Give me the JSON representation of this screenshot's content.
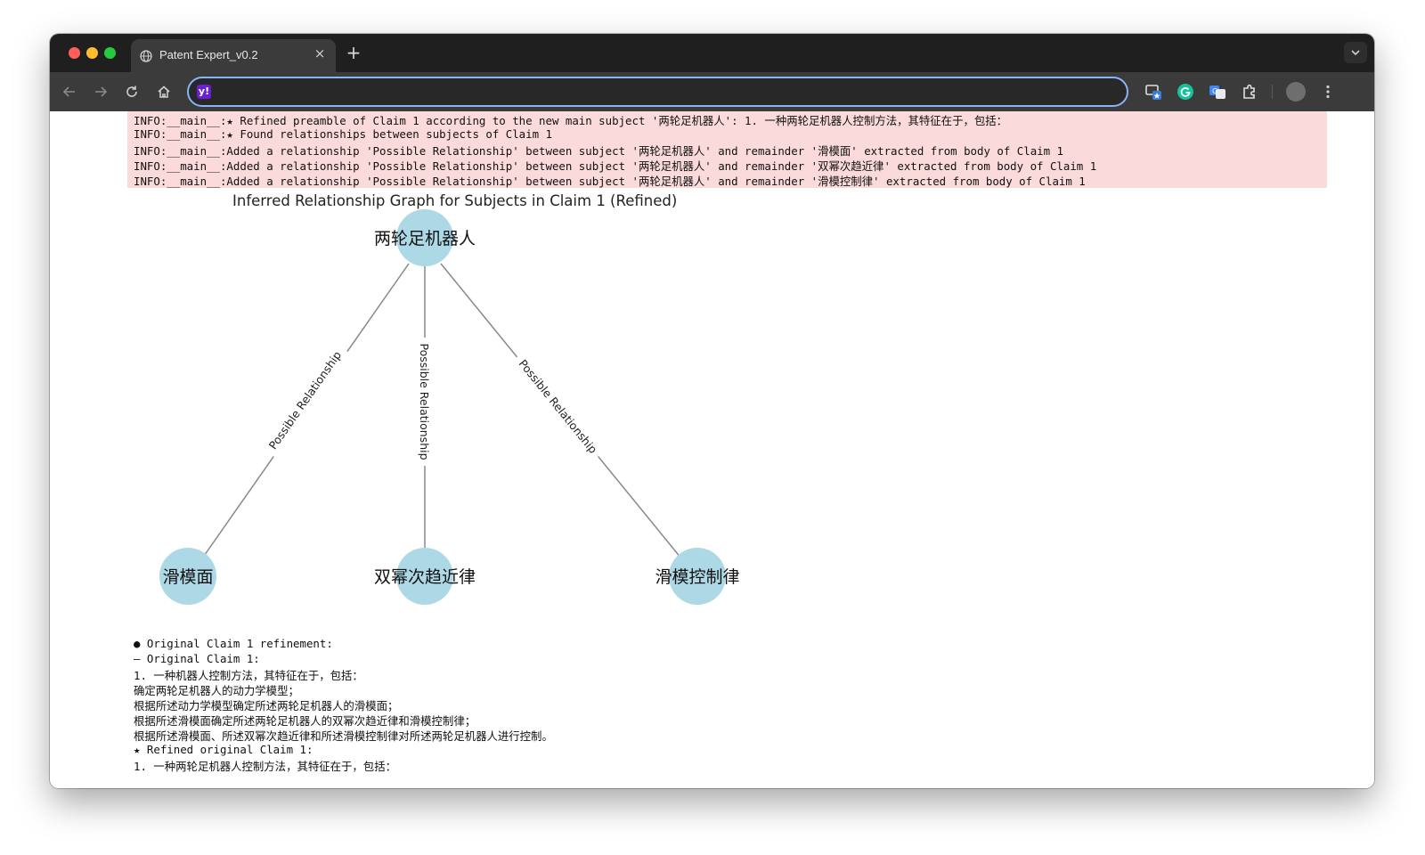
{
  "browser": {
    "tab_title": "Patent Expert_v0.2",
    "tab_close": "×",
    "new_tab": "+",
    "address_value": "",
    "omnibox_icon_text": "y!"
  },
  "log": {
    "lines": [
      "INFO:__main__:★ Refined preamble of Claim 1 according to the new main subject '两轮足机器人': 1. 一种两轮足机器人控制方法，其特征在于，包括：",
      "INFO:__main__:★ Found relationships between subjects of Claim 1",
      "INFO:__main__:Added a relationship 'Possible Relationship' between subject '两轮足机器人' and remainder '滑模面' extracted from body of Claim 1",
      "INFO:__main__:Added a relationship 'Possible Relationship' between subject '两轮足机器人' and remainder '双幂次趋近律' extracted from body of Claim 1",
      "INFO:__main__:Added a relationship 'Possible Relationship' between subject '两轮足机器人' and remainder '滑模控制律' extracted from body of Claim 1"
    ]
  },
  "graph": {
    "title": "Inferred Relationship Graph for Subjects in Claim 1 (Refined)",
    "node_color": "#add8e6",
    "edge_color": "#888888",
    "nodes": {
      "root": "两轮足机器人",
      "child1": "滑模面",
      "child2": "双幂次趋近律",
      "child3": "滑模控制律"
    },
    "edges": {
      "e1": "Possible Relationship",
      "e2": "Possible Relationship",
      "e3": "Possible Relationship"
    }
  },
  "output": {
    "lines": [
      "● Original Claim 1 refinement:",
      "— Original Claim 1:",
      "1. 一种机器人控制方法，其特征在于，包括：",
      "确定两轮足机器人的动力学模型；",
      "根据所述动力学模型确定所述两轮足机器人的滑模面；",
      "根据所述滑模面确定所述两轮足机器人的双幂次趋近律和滑模控制律；",
      "根据所述滑模面、所述双幂次趋近律和所述滑模控制律对所述两轮足机器人进行控制。",
      "★ Refined original Claim 1:",
      "1. 一种两轮足机器人控制方法，其特征在于，包括："
    ]
  }
}
